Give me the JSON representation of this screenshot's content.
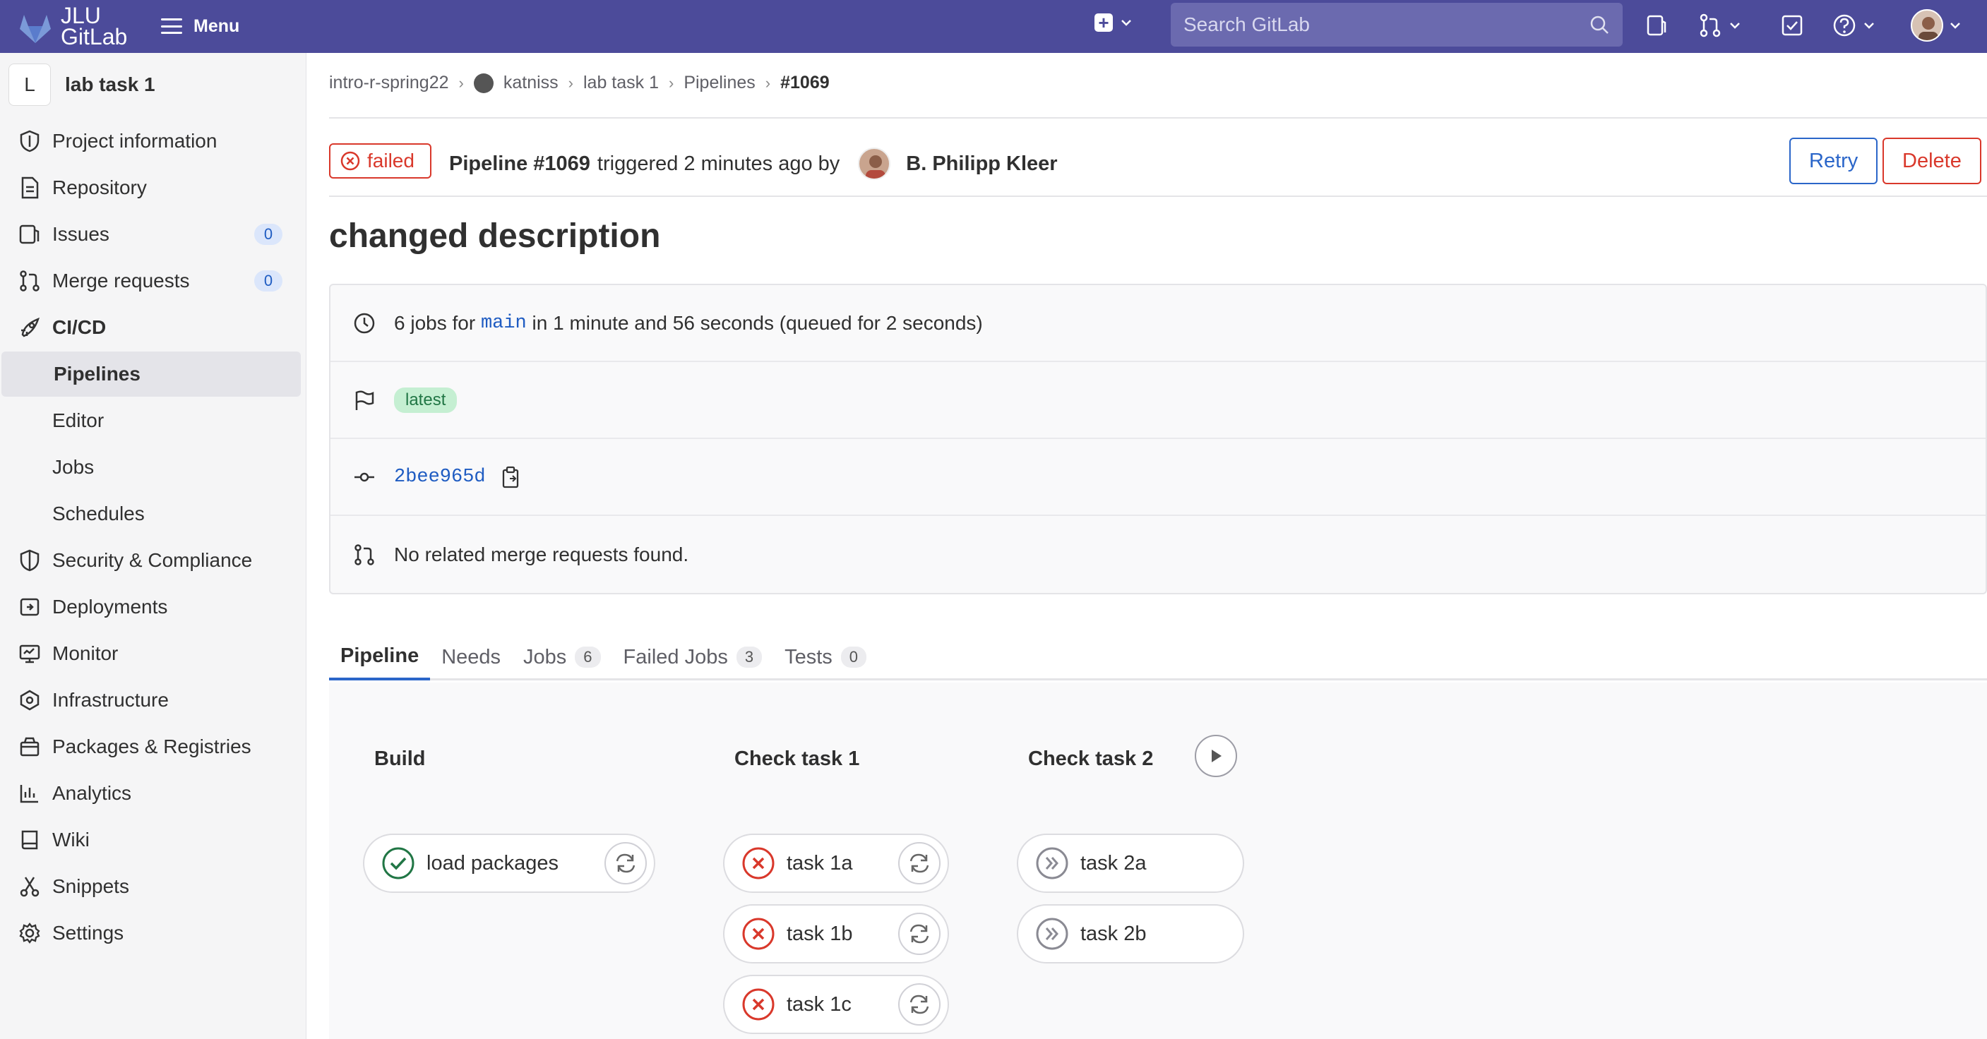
{
  "topbar": {
    "logo_text_line1": "JLU",
    "logo_text_line2": "GitLab",
    "menu_label": "Menu",
    "search_placeholder": "Search GitLab",
    "accent": "#4c4b9a"
  },
  "sidebar": {
    "project_initial": "L",
    "project_name": "lab task 1",
    "items": [
      {
        "label": "Project information",
        "icon": "info-shield-icon"
      },
      {
        "label": "Repository",
        "icon": "document-icon"
      },
      {
        "label": "Issues",
        "icon": "issues-icon",
        "badge": "0"
      },
      {
        "label": "Merge requests",
        "icon": "merge-request-icon",
        "badge": "0"
      },
      {
        "label": "CI/CD",
        "icon": "rocket-icon"
      },
      {
        "label": "Pipelines"
      },
      {
        "label": "Editor"
      },
      {
        "label": "Jobs"
      },
      {
        "label": "Schedules"
      },
      {
        "label": "Security & Compliance",
        "icon": "shield-icon"
      },
      {
        "label": "Deployments",
        "icon": "deployments-icon"
      },
      {
        "label": "Monitor",
        "icon": "monitor-icon"
      },
      {
        "label": "Infrastructure",
        "icon": "infrastructure-icon"
      },
      {
        "label": "Packages & Registries",
        "icon": "package-icon"
      },
      {
        "label": "Analytics",
        "icon": "analytics-icon"
      },
      {
        "label": "Wiki",
        "icon": "book-icon"
      },
      {
        "label": "Snippets",
        "icon": "scissors-icon"
      },
      {
        "label": "Settings",
        "icon": "gear-icon"
      }
    ]
  },
  "breadcrumb": {
    "items": [
      "intro-r-spring22",
      "katniss",
      "lab task 1",
      "Pipelines",
      "#1069"
    ],
    "separator": "›"
  },
  "pipeline": {
    "status": "failed",
    "title_bold": "Pipeline #1069",
    "triggered_text": "triggered 2 minutes ago by",
    "user": "B. Philipp Kleer",
    "retry_label": "Retry",
    "delete_label": "Delete",
    "commit_title": "changed description"
  },
  "info": {
    "jobs_prefix": "6 jobs for",
    "branch": "main",
    "jobs_suffix": "in 1 minute and 56 seconds (queued for 2 seconds)",
    "tag": "latest",
    "commit_sha": "2bee965d",
    "mr_text": "No related merge requests found."
  },
  "tabs": [
    {
      "label": "Pipeline"
    },
    {
      "label": "Needs"
    },
    {
      "label": "Jobs",
      "count": "6"
    },
    {
      "label": "Failed Jobs",
      "count": "3"
    },
    {
      "label": "Tests",
      "count": "0"
    }
  ],
  "stages": [
    {
      "name": "Build",
      "jobs": [
        {
          "name": "load packages",
          "status": "success"
        }
      ]
    },
    {
      "name": "Check task 1",
      "jobs": [
        {
          "name": "task 1a",
          "status": "failed"
        },
        {
          "name": "task 1b",
          "status": "failed"
        },
        {
          "name": "task 1c",
          "status": "failed"
        }
      ]
    },
    {
      "name": "Check task 2",
      "jobs": [
        {
          "name": "task 2a",
          "status": "skipped"
        },
        {
          "name": "task 2b",
          "status": "skipped"
        }
      ]
    }
  ],
  "colors": {
    "failed": "#d9382b",
    "success": "#217645",
    "link": "#1f5cc2",
    "skipped": "#8a8a93"
  }
}
